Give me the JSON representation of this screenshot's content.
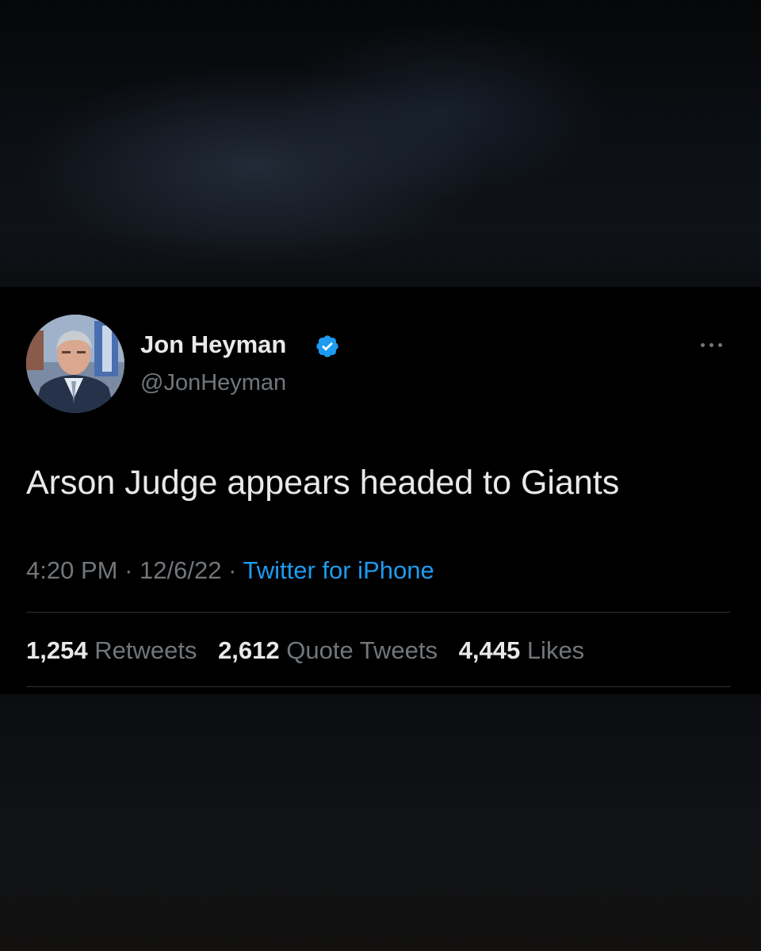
{
  "tweet": {
    "author": {
      "name": "Jon Heyman",
      "handle": "@JonHeyman",
      "verified": true
    },
    "text": "Arson Judge appears headed to Giants",
    "time": "4:20 PM",
    "separator": "·",
    "date": "12/6/22",
    "source": "Twitter for iPhone",
    "stats": {
      "retweets": {
        "count": "1,254",
        "label": "Retweets"
      },
      "quote_tweets": {
        "count": "2,612",
        "label": "Quote Tweets"
      },
      "likes": {
        "count": "4,445",
        "label": "Likes"
      }
    }
  },
  "icons": {
    "verified_badge": "verified-badge-icon",
    "more": "more-options-icon",
    "avatar": "profile-photo"
  },
  "colors": {
    "background": "#000000",
    "text_primary": "#e7e9ea",
    "text_secondary": "#71767b",
    "link": "#1d9bf0",
    "verified": "#1d9bf0",
    "divider": "#2f3336"
  }
}
